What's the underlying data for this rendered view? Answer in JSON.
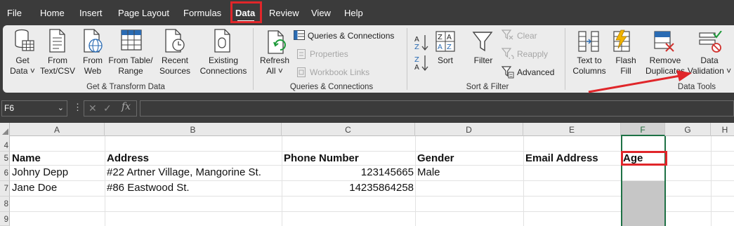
{
  "menu": {
    "tabs": [
      "File",
      "Home",
      "Insert",
      "Page Layout",
      "Formulas",
      "Data",
      "Review",
      "View",
      "Help"
    ],
    "active_tab": "Data"
  },
  "ribbon": {
    "get_data": "Get\nData ˅",
    "from_text_csv": "From\nText/CSV",
    "from_web": "From\nWeb",
    "from_table_range": "From Table/\nRange",
    "recent_sources": "Recent\nSources",
    "existing_connections": "Existing\nConnections",
    "group_get_transform": "Get & Transform Data",
    "refresh_all": "Refresh\nAll ˅",
    "queries_connections": "Queries & Connections",
    "properties": "Properties",
    "workbook_links": "Workbook Links",
    "group_queries": "Queries & Connections",
    "sort": "Sort",
    "filter": "Filter",
    "clear": "Clear",
    "reapply": "Reapply",
    "advanced": "Advanced",
    "group_sort_filter": "Sort & Filter",
    "text_to_columns": "Text to\nColumns",
    "flash_fill": "Flash\nFill",
    "remove_duplicates": "Remove\nDuplicates",
    "data_validation": "Data\nValidation ˅",
    "group_data_tools": "Data Tools"
  },
  "formula_bar": {
    "name_box": "F6",
    "formula": ""
  },
  "sheet": {
    "columns": [
      "A",
      "B",
      "C",
      "D",
      "E",
      "F",
      "G",
      "H"
    ],
    "rows": [
      "4",
      "5",
      "6",
      "7",
      "8",
      "9"
    ],
    "headers": {
      "name": "Name",
      "address": "Address",
      "phone": "Phone Number",
      "gender": "Gender",
      "email": "Email Address",
      "age": "Age"
    },
    "records": [
      {
        "name": "Johny Depp",
        "address": "#22 Artner Village, Mangorine St.",
        "phone": "123145665",
        "gender": "Male",
        "email": "",
        "age": ""
      },
      {
        "name": "Jane Doe",
        "address": "#86 Eastwood St.",
        "phone": "14235864258",
        "gender": "",
        "email": "",
        "age": ""
      }
    ]
  },
  "colors": {
    "accent_red": "#e0262a",
    "excel_green": "#1e7145",
    "selection_grey": "#c6c6c6",
    "chrome_dark": "#3b3b3b"
  }
}
